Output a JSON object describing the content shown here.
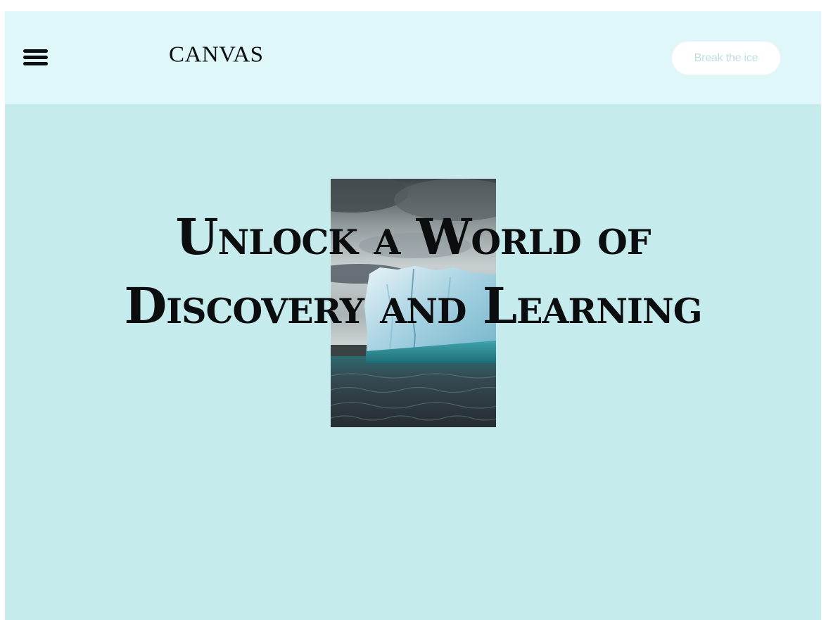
{
  "header": {
    "menu_icon": "hamburger-menu-icon",
    "logo_text": "CANVAS",
    "cta_label": "Break the ice"
  },
  "hero": {
    "headline_line1": "Unlock a World of",
    "headline_line2": "Discovery and Learning",
    "image": "iceberg-in-ocean-photo"
  },
  "colors": {
    "header_bg": "#dff7f9",
    "hero_bg": "#c5ebed",
    "text": "#0b0d0e",
    "cta_bg": "#ffffff",
    "cta_text": "#bfdfe1"
  }
}
